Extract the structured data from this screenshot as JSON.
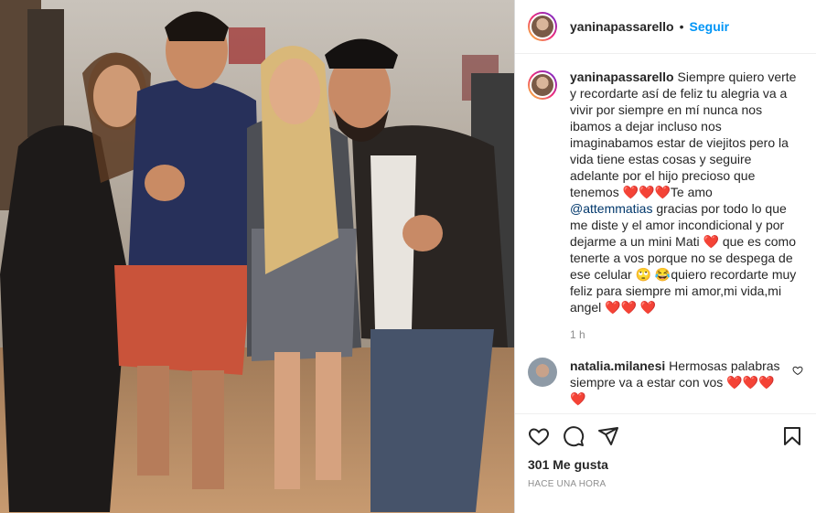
{
  "header": {
    "username": "yaninapassarello",
    "separator": "•",
    "follow_label": "Seguir"
  },
  "caption": {
    "username": "yaninapassarello",
    "text_1": " Siempre quiero verte y recordarte así de feliz tu alegria va a vivir por siempre en mí nunca nos ibamos a dejar incluso nos imaginabamos estar de viejitos pero la vida tiene estas cosas y seguire adelante por el hijo precioso que tenemos ",
    "hearts_1": "❤️❤️❤️",
    "text_2": "Te amo ",
    "mention": "@attemmatias",
    "text_3": " gracias por todo lo que me diste y el amor incondicional y por dejarme a un mini Mati ",
    "heart_2": "❤️",
    "text_4": " que es como tenerte a vos porque no se despega de ese celular ",
    "emoji_1": "🙄",
    "emoji_2": "😂",
    "text_5": "quiero recordarte muy feliz para siempre mi amor,mi vida,mi angel ",
    "hearts_3": "❤️❤️",
    "hearts_4": "❤️",
    "time": "1 h"
  },
  "comment": {
    "username": "natalia.milanesi",
    "text": " Hermosas palabras siempre va a estar con vos ",
    "hearts": "❤️❤️❤️",
    "hearts_2": "❤️"
  },
  "likes": "301 Me gusta",
  "posted_ago": "HACE UNA HORA",
  "icons": [
    "heart-icon",
    "comment-icon",
    "share-icon",
    "bookmark-icon",
    "small-heart-icon"
  ],
  "colors": {
    "follow": "#0095f6",
    "mention": "#00376b",
    "text": "#262626",
    "muted": "#8e8e8e"
  }
}
